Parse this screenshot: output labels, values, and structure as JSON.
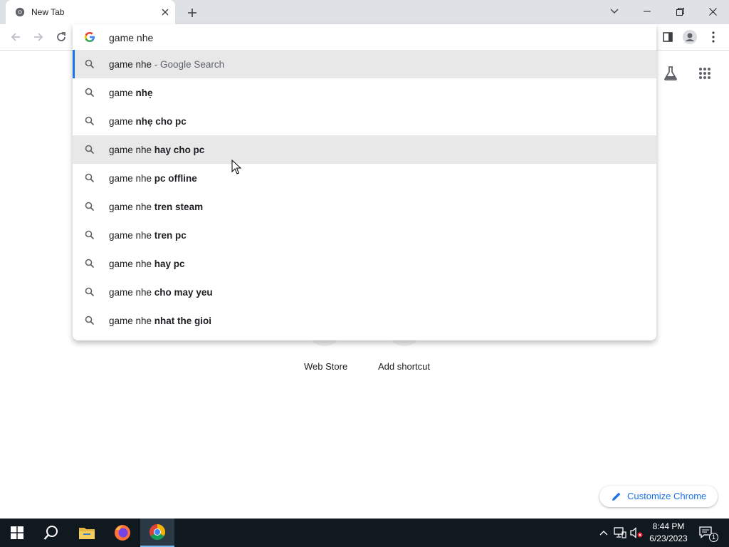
{
  "browser": {
    "tab": {
      "title": "New Tab"
    },
    "omnibox": {
      "input_value": "game nhe",
      "suggestions": [
        {
          "prefix": "game nhe",
          "bold": "",
          "suffix": " - Google Search"
        },
        {
          "prefix": "game ",
          "bold": "nhẹ",
          "suffix": ""
        },
        {
          "prefix": "game ",
          "bold": "nhẹ cho pc",
          "suffix": ""
        },
        {
          "prefix": "game nhe ",
          "bold": "hay cho pc",
          "suffix": ""
        },
        {
          "prefix": "game nhe ",
          "bold": "pc offline",
          "suffix": ""
        },
        {
          "prefix": "game nhe ",
          "bold": "tren steam",
          "suffix": ""
        },
        {
          "prefix": "game nhe ",
          "bold": "tren pc",
          "suffix": ""
        },
        {
          "prefix": "game nhe ",
          "bold": "hay pc",
          "suffix": ""
        },
        {
          "prefix": "game nhe ",
          "bold": "cho may yeu",
          "suffix": ""
        },
        {
          "prefix": "game nhe ",
          "bold": "nhat the gioi",
          "suffix": ""
        }
      ]
    }
  },
  "ntp": {
    "shortcuts": [
      {
        "label": "Web Store"
      },
      {
        "label": "Add shortcut"
      }
    ],
    "customize_label": "Customize Chrome"
  },
  "taskbar": {
    "time": "8:44 PM",
    "date": "6/23/2023",
    "notification_count": "1"
  },
  "colors": {
    "accent": "#1a73e8",
    "tabstrip": "#dee1e6",
    "highlight": "#e8e8e9",
    "taskbar": "#101820"
  }
}
